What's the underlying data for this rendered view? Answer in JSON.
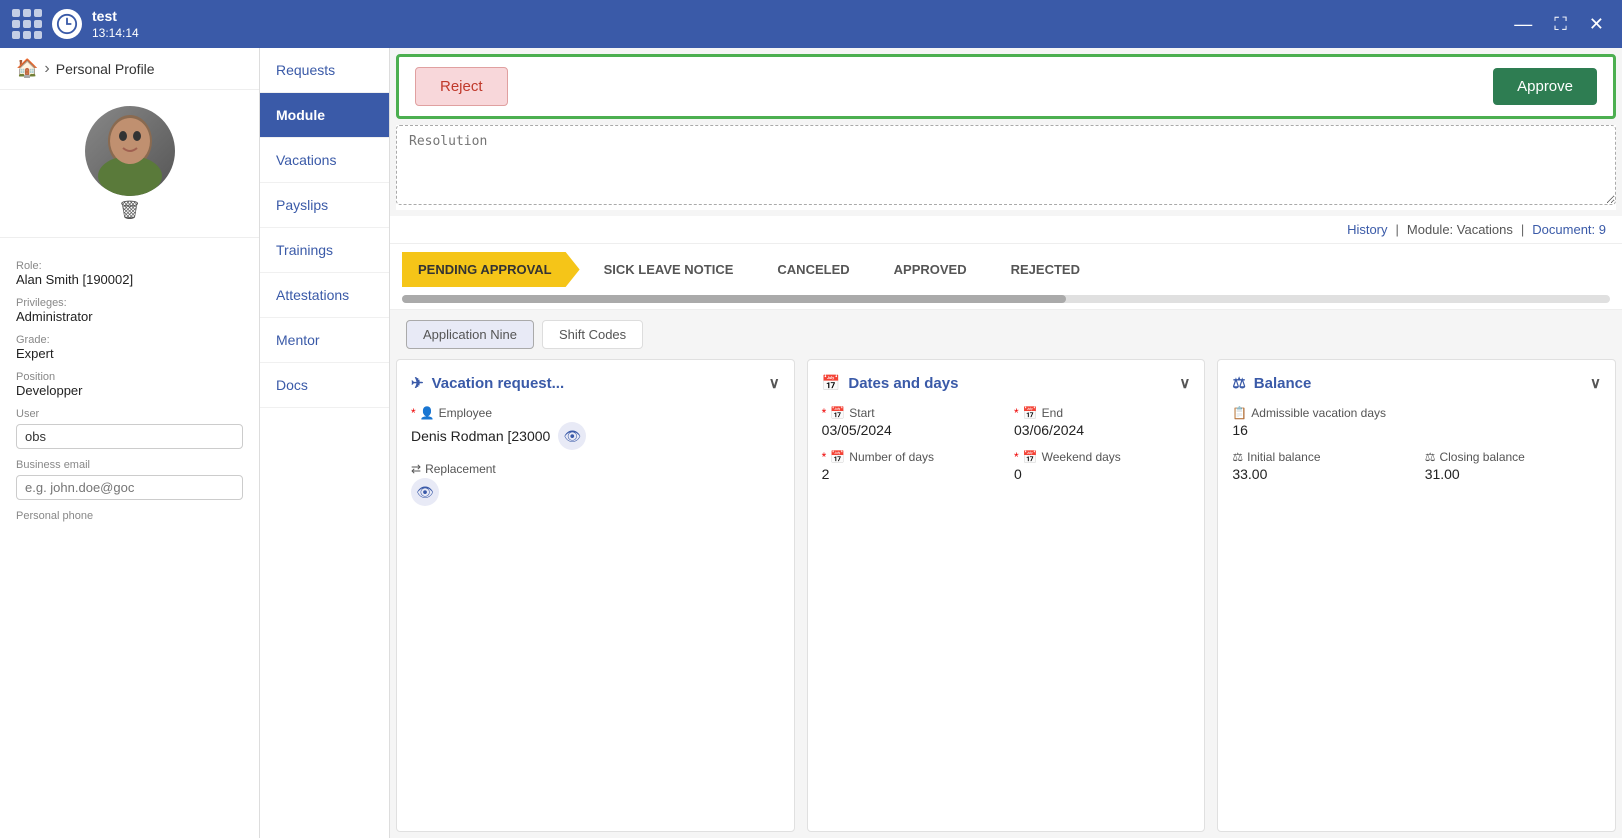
{
  "topbar": {
    "app_name": "test",
    "app_time": "13:14:14",
    "minimize_label": "—",
    "maximize_label": "⛶",
    "close_label": "✕"
  },
  "sidebar": {
    "home_icon": "🏠",
    "breadcrumb_arrow": "›",
    "breadcrumb_text": "Personal Profile",
    "role_label": "Role:",
    "role_value": "Alan Smith [190002]",
    "privileges_label": "Privileges:",
    "privileges_value": "Administrator",
    "grade_label": "Grade:",
    "grade_value": "Expert",
    "position_label": "Position",
    "position_value": "Developper",
    "user_label": "User",
    "user_value": "obs",
    "email_label": "Business email",
    "email_placeholder": "e.g. john.doe@goc",
    "phone_label": "Personal phone"
  },
  "left_nav": {
    "items": [
      {
        "id": "requests",
        "label": "Requests",
        "active": false
      },
      {
        "id": "module",
        "label": "Module",
        "active": true
      },
      {
        "id": "vacations",
        "label": "Vacations",
        "active": false
      },
      {
        "id": "payslips",
        "label": "Payslips",
        "active": false
      },
      {
        "id": "trainings",
        "label": "Trainings",
        "active": false
      },
      {
        "id": "attestations",
        "label": "Attestations",
        "active": false
      },
      {
        "id": "mentor",
        "label": "Mentor",
        "active": false
      },
      {
        "id": "docs",
        "label": "Docs",
        "active": false
      }
    ]
  },
  "action_bar": {
    "reject_label": "Reject",
    "approve_label": "Approve"
  },
  "resolution": {
    "placeholder": "Resolution"
  },
  "history_bar": {
    "history_label": "History",
    "separator1": "|",
    "module_label": "Module: Vacations",
    "separator2": "|",
    "document_label": "Document: 9"
  },
  "workflow": {
    "steps": [
      {
        "id": "pending",
        "label": "PENDING APPROVAL",
        "active": true
      },
      {
        "id": "sick",
        "label": "SICK LEAVE NOTICE",
        "active": false
      },
      {
        "id": "canceled",
        "label": "CANCELED",
        "active": false
      },
      {
        "id": "approved",
        "label": "APPROVED",
        "active": false
      },
      {
        "id": "rejected",
        "label": "REJECTED",
        "active": false
      }
    ]
  },
  "tabs": {
    "items": [
      {
        "id": "app9",
        "label": "Application Nine",
        "active": true
      },
      {
        "id": "shift",
        "label": "Shift Codes",
        "active": false
      }
    ]
  },
  "cards": {
    "vacation_request": {
      "title": "Vacation request...",
      "icon": "✈",
      "employee_label": "Employee",
      "employee_value": "Denis Rodman [23000",
      "replacement_label": "Replacement",
      "required_marker": "*"
    },
    "dates_and_days": {
      "title": "Dates and days",
      "icon": "📅",
      "start_label": "Start",
      "end_label": "End",
      "start_value": "03/05/2024",
      "end_value": "03/06/2024",
      "num_days_label": "Number of days",
      "weekend_days_label": "Weekend days",
      "num_days_value": "2",
      "weekend_days_value": "0",
      "required_marker": "*"
    },
    "balance": {
      "title": "Balance",
      "icon": "⚖",
      "admissible_label": "Admissible vacation days",
      "admissible_value": "16",
      "initial_balance_label": "Initial balance",
      "closing_balance_label": "Closing balance",
      "initial_value": "33.00",
      "closing_value": "31.00"
    }
  },
  "colors": {
    "accent_blue": "#3a5aa8",
    "accent_green": "#2e7d52",
    "workflow_yellow": "#f5c518",
    "border_green": "#4caf50"
  }
}
